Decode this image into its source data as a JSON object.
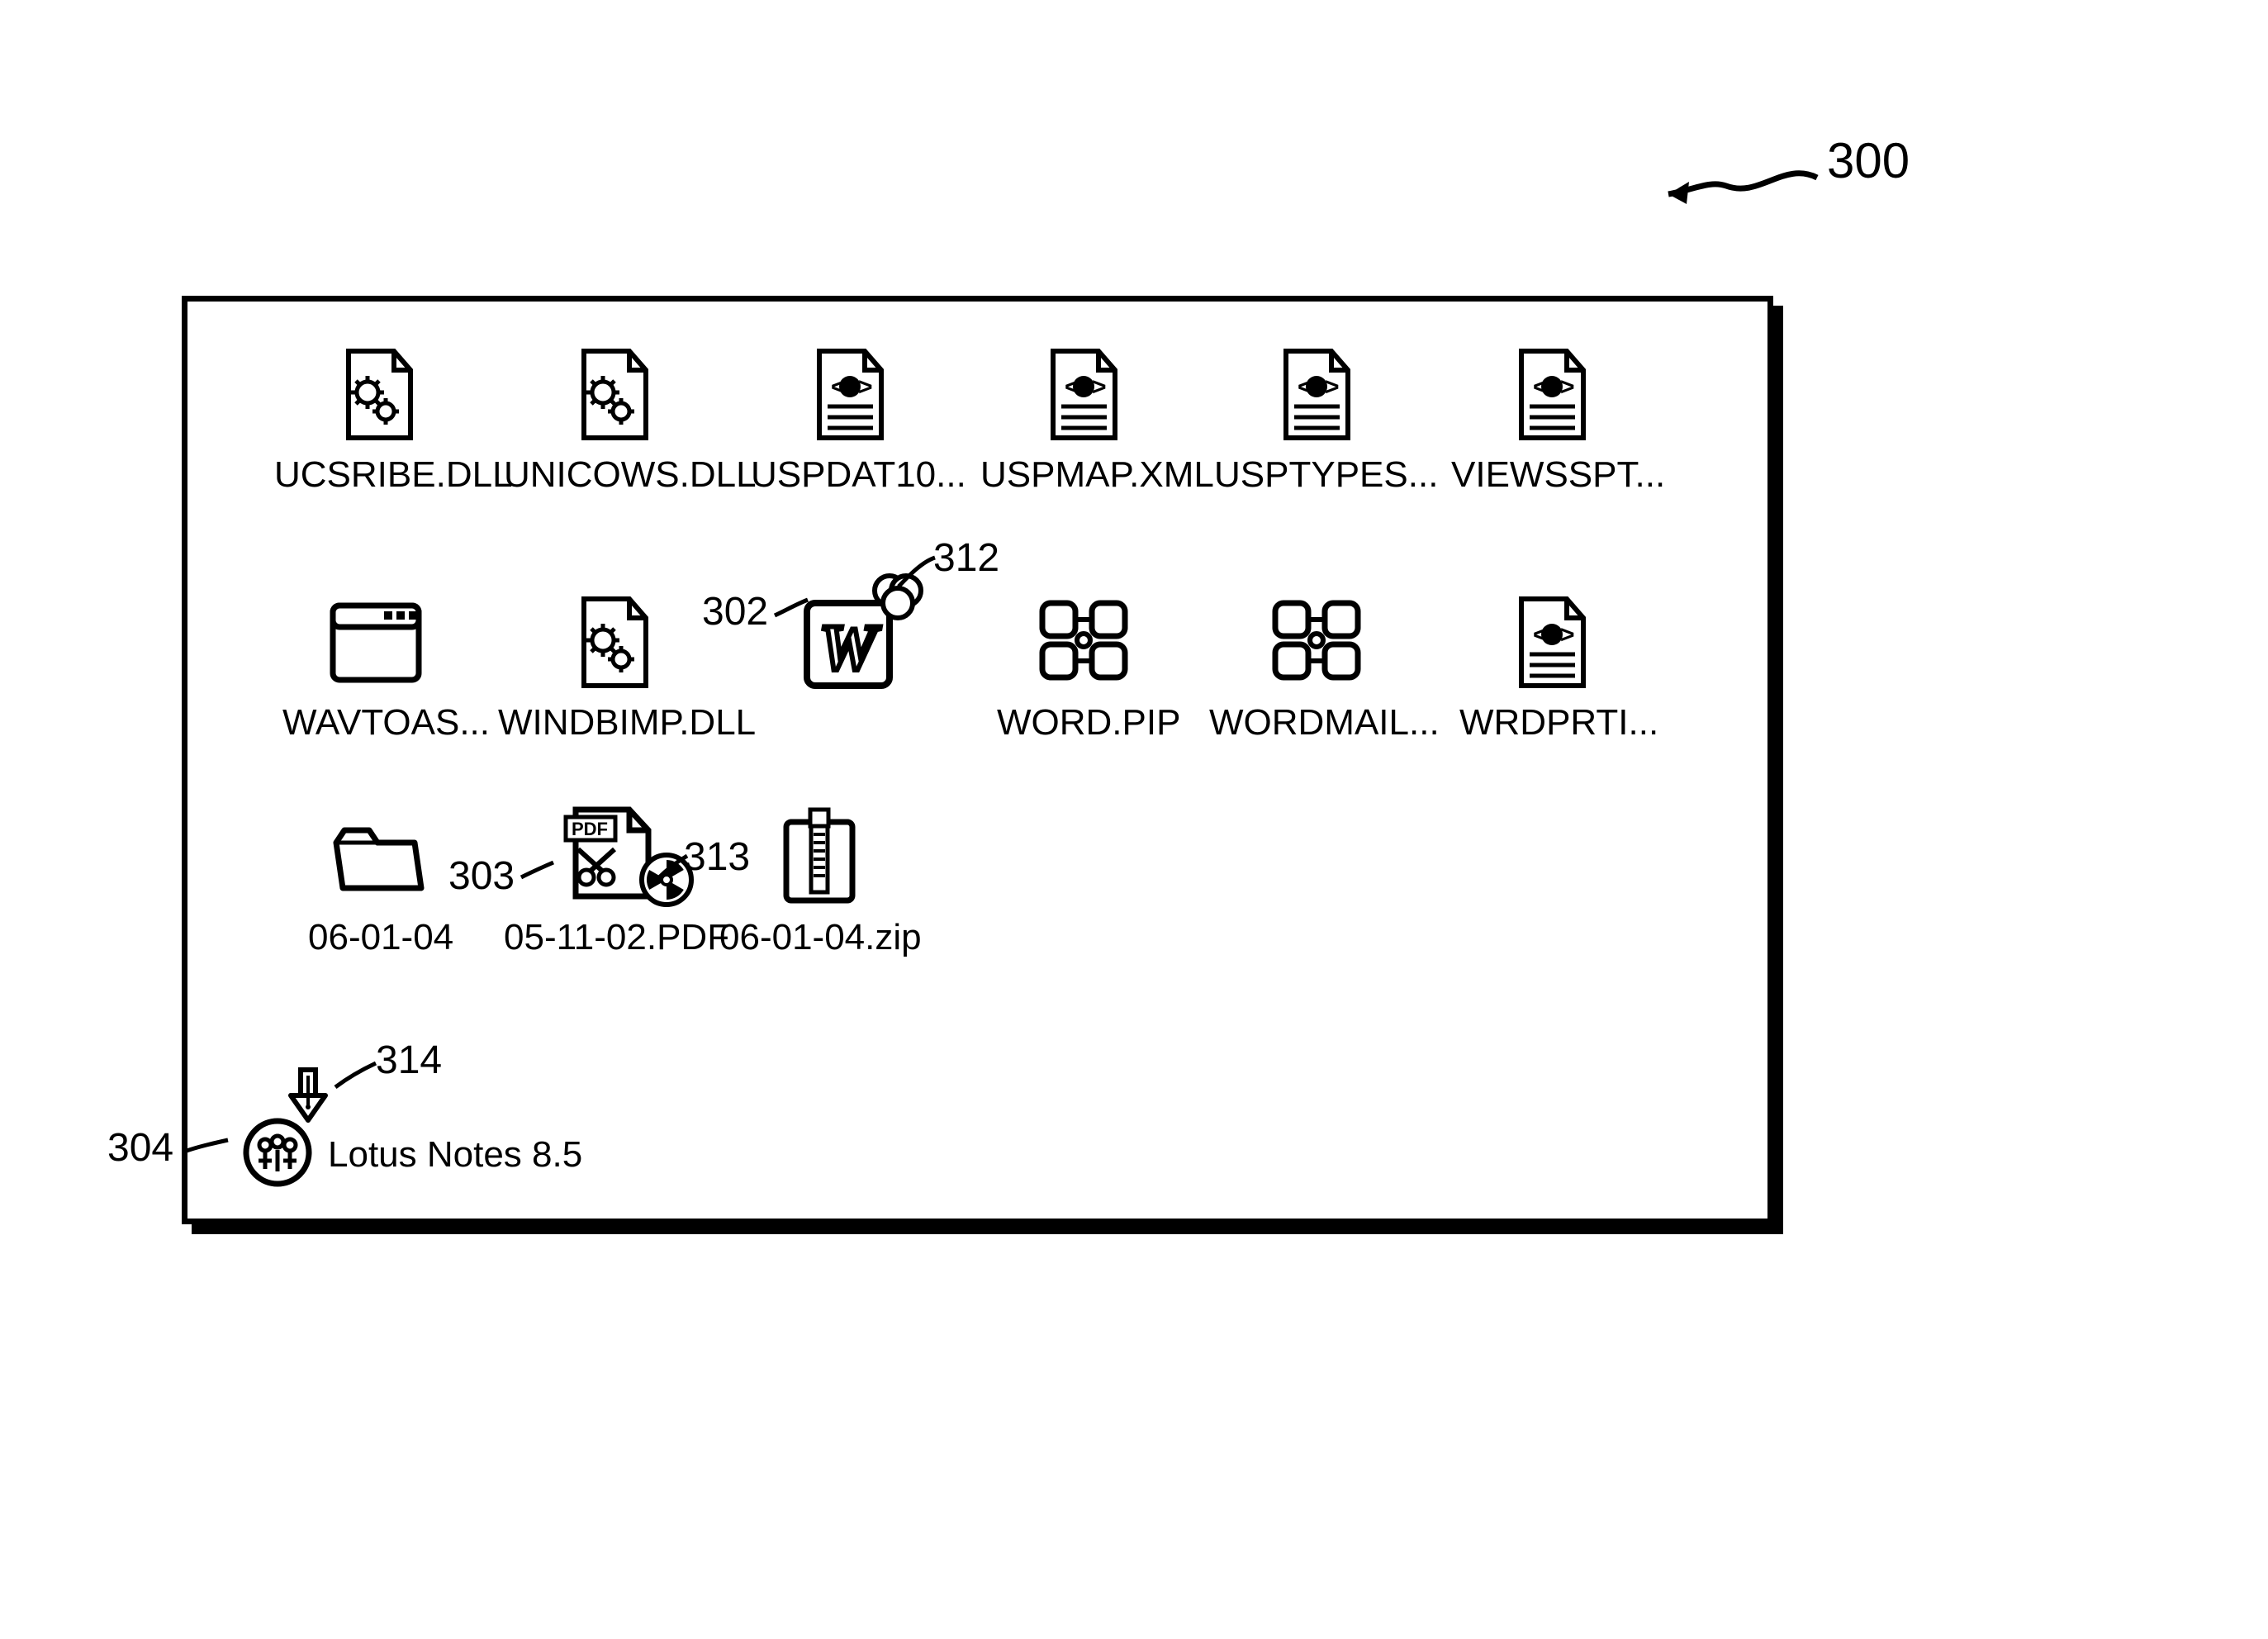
{
  "figure_ref": "300",
  "callouts": {
    "c302": "302",
    "c303": "303",
    "c304": "304",
    "c312": "312",
    "c313": "313",
    "c314": "314"
  },
  "desktop_item": {
    "label": "Lotus Notes 8.5"
  },
  "files": {
    "row1": [
      {
        "label": "UCSRIBE.DLL",
        "icon": "gears"
      },
      {
        "label": "UNICOWS.DLL",
        "icon": "gears"
      },
      {
        "label": "USPDAT10...",
        "icon": "xml"
      },
      {
        "label": "USPMAP.XML",
        "icon": "xml"
      },
      {
        "label": "USPTYPES...",
        "icon": "xml"
      },
      {
        "label": "VIEWSSPT...",
        "icon": "xml"
      }
    ],
    "row2": [
      {
        "label": "WAVTOAS...",
        "icon": "window"
      },
      {
        "label": "WINDBIMP.DLL",
        "icon": "gears"
      },
      {
        "label": "",
        "icon": "word"
      },
      {
        "label": "WORD.PIP",
        "icon": "pip"
      },
      {
        "label": "WORDMAIL...",
        "icon": "pip"
      },
      {
        "label": "WRDPRTI...",
        "icon": "xml"
      }
    ],
    "row3": [
      {
        "label": "06-01-04",
        "icon": "folder"
      },
      {
        "label": "05-11-02.PDF",
        "icon": "pdf"
      },
      {
        "label": "06-01-04.zip",
        "icon": "zip"
      }
    ]
  }
}
